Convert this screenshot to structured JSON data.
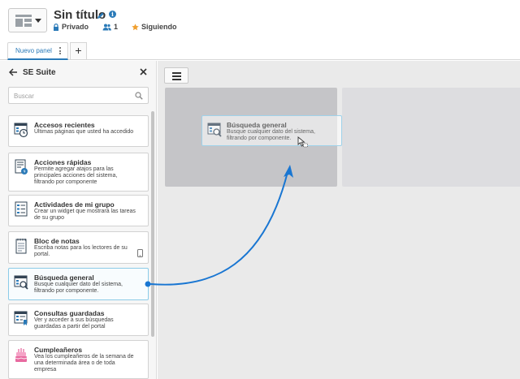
{
  "header": {
    "title": "Sin título",
    "privacy": "Privado",
    "members_count": "1",
    "follow_label": "Siguiendo"
  },
  "tabs": [
    {
      "label": "Nuevo panel"
    }
  ],
  "add_tab_symbol": "+",
  "sidebar": {
    "title": "SE Suite",
    "search_placeholder": "Buscar",
    "items": [
      {
        "title": "Accesos recientes",
        "description": "Últimas páginas que usted ha accedido",
        "icon": "recent-access-icon"
      },
      {
        "title": "Acciones rápidas",
        "description": "Permite agregar atajos para las principales acciones del sistema, filtrando por componente",
        "icon": "quick-actions-icon"
      },
      {
        "title": "Actividades de mi grupo",
        "description": "Crear un widget que mostrará las tareas de su grupo",
        "icon": "group-activities-icon"
      },
      {
        "title": "Bloc de notas",
        "description": "Escriba notas para los lectores de su portal.",
        "icon": "notepad-icon"
      },
      {
        "title": "Búsqueda general",
        "description": "Busque cualquier dato del sistema, filtrando por componente.",
        "icon": "general-search-icon"
      },
      {
        "title": "Consultas guardadas",
        "description": "Ver y acceder a sus búsquedas guardadas a partir del portal",
        "icon": "saved-queries-icon"
      },
      {
        "title": "Cumpleañeros",
        "description": "Vea los cumpleañeros de la semana de una determinada área o de toda empresa",
        "icon": "birthday-cake-icon"
      }
    ]
  },
  "drag_preview": {
    "title": "Búsqueda general",
    "description": "Busque cualquier dato del sistema, filtrando por componente."
  },
  "colors": {
    "accent": "#2a7ab8",
    "drag_arrow": "#1976d2",
    "drop_slot": "#c5c5c8",
    "follow_star": "#f0a030"
  }
}
